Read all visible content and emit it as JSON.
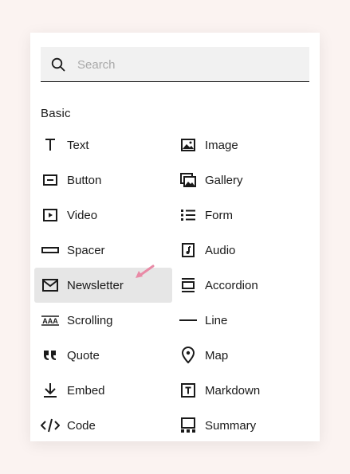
{
  "search": {
    "placeholder": "Search",
    "icon": "search-icon"
  },
  "section": {
    "title": "Basic"
  },
  "items": [
    {
      "label": "Text",
      "icon": "text-icon"
    },
    {
      "label": "Image",
      "icon": "image-icon"
    },
    {
      "label": "Button",
      "icon": "button-icon"
    },
    {
      "label": "Gallery",
      "icon": "gallery-icon"
    },
    {
      "label": "Video",
      "icon": "video-icon"
    },
    {
      "label": "Form",
      "icon": "form-icon"
    },
    {
      "label": "Spacer",
      "icon": "spacer-icon"
    },
    {
      "label": "Audio",
      "icon": "audio-icon"
    },
    {
      "label": "Newsletter",
      "icon": "newsletter-icon",
      "active": true
    },
    {
      "label": "Accordion",
      "icon": "accordion-icon"
    },
    {
      "label": "Scrolling",
      "icon": "scrolling-icon"
    },
    {
      "label": "Line",
      "icon": "line-icon"
    },
    {
      "label": "Quote",
      "icon": "quote-icon"
    },
    {
      "label": "Map",
      "icon": "map-icon"
    },
    {
      "label": "Embed",
      "icon": "embed-icon"
    },
    {
      "label": "Markdown",
      "icon": "markdown-icon"
    },
    {
      "label": "Code",
      "icon": "code-icon"
    },
    {
      "label": "Summary",
      "icon": "summary-icon"
    }
  ],
  "colors": {
    "background": "#fbf3f1",
    "panel": "#ffffff",
    "active": "#e6e6e6",
    "cursor": "#e98aa6"
  }
}
